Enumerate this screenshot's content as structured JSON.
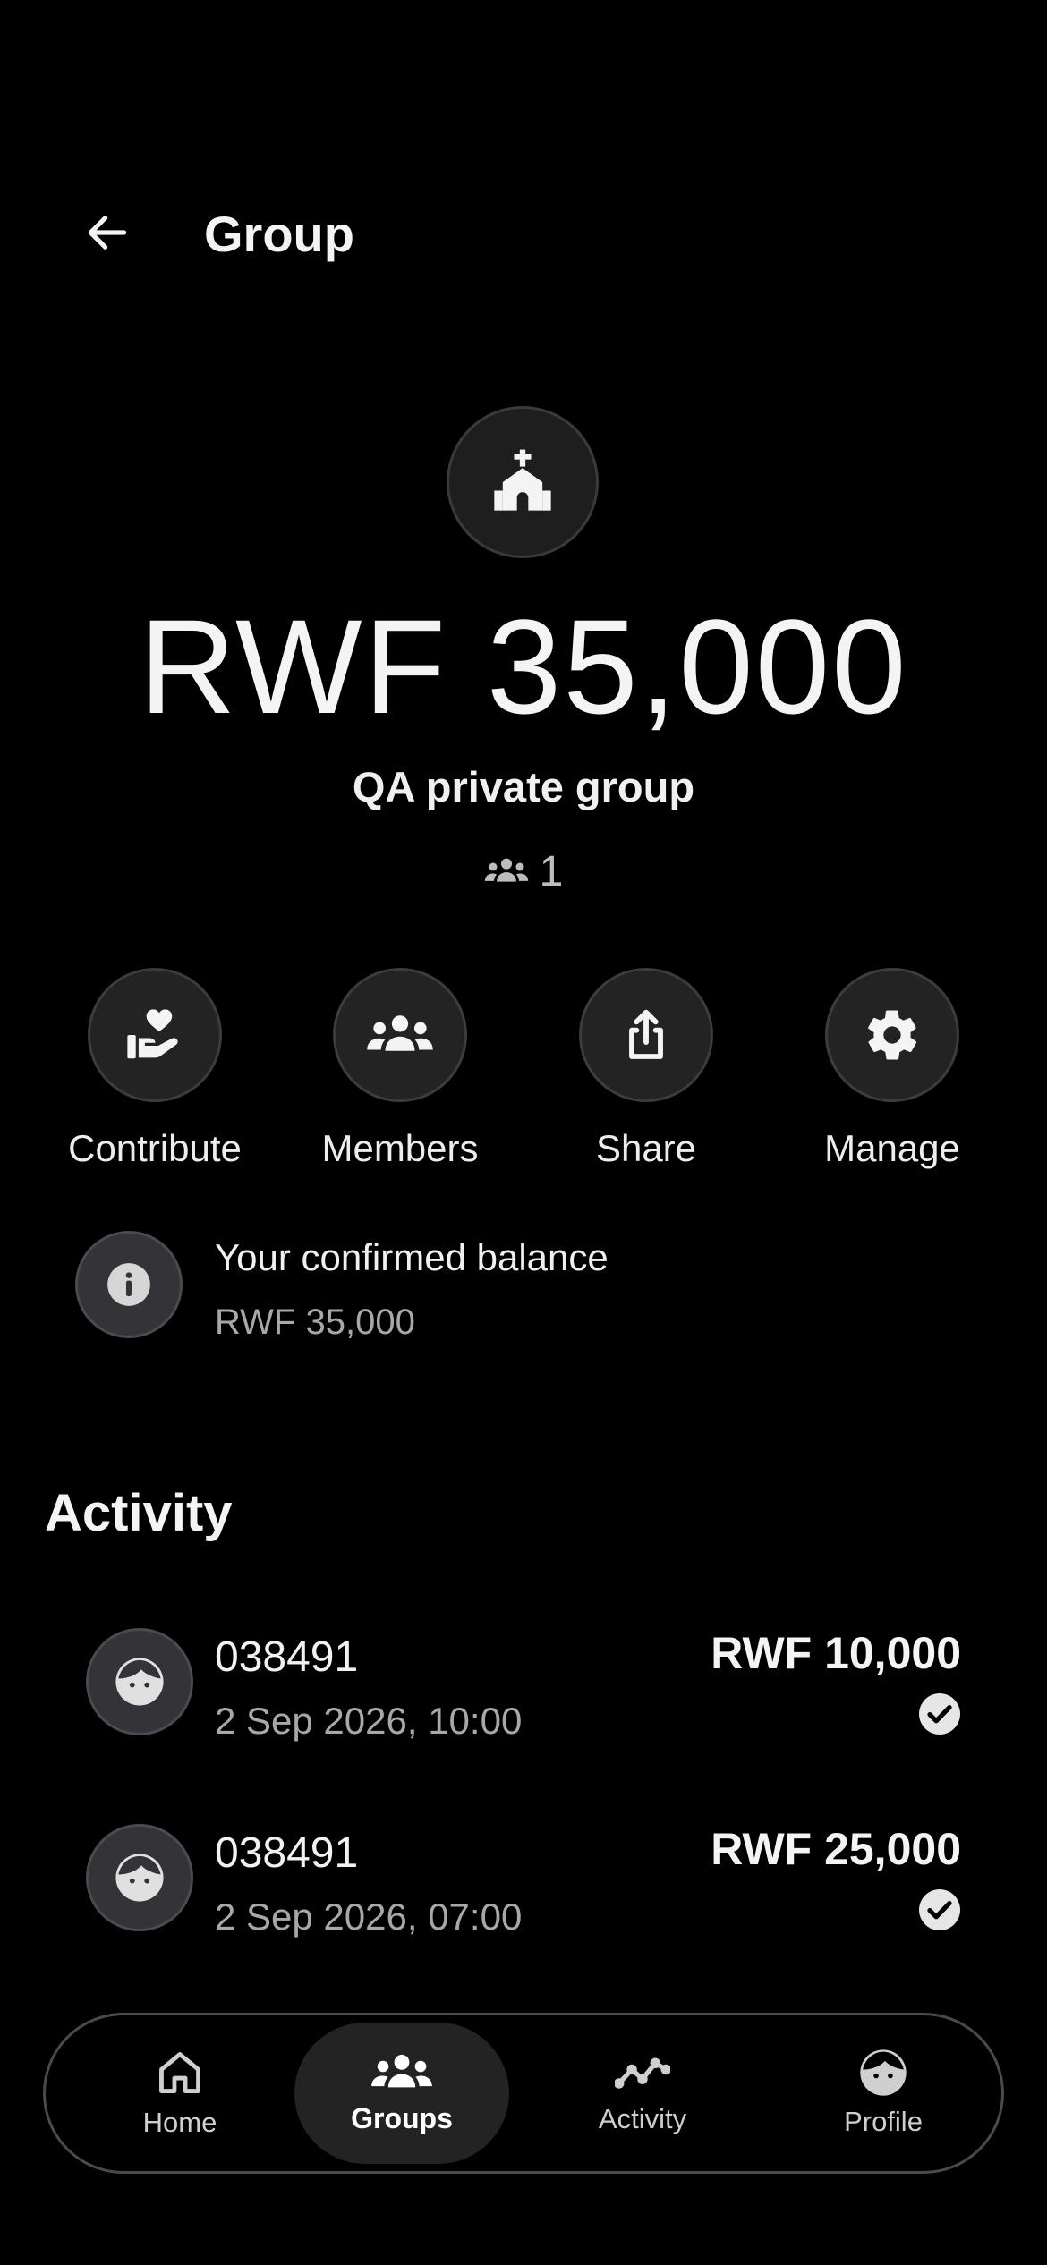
{
  "header": {
    "title": "Group",
    "back_icon": "arrow-left-icon"
  },
  "group": {
    "icon": "church-icon",
    "balance": "RWF 35,000",
    "name": "QA private group",
    "member_count": "1",
    "member_icon": "people-icon"
  },
  "actions": [
    {
      "label": "Contribute",
      "icon": "hand-heart-icon"
    },
    {
      "label": "Members",
      "icon": "people-icon"
    },
    {
      "label": "Share",
      "icon": "share-icon"
    },
    {
      "label": "Manage",
      "icon": "gear-icon"
    }
  ],
  "confirmed": {
    "icon": "info-icon",
    "title": "Your confirmed balance",
    "value": "RWF 35,000"
  },
  "activity": {
    "title": "Activity",
    "items": [
      {
        "name": "038491",
        "date": "2 Sep 2026, 10:00",
        "amount": "RWF 10,000",
        "status_icon": "check-circle-icon"
      },
      {
        "name": "038491",
        "date": "2 Sep 2026, 07:00",
        "amount": "RWF 25,000",
        "status_icon": "check-circle-icon"
      }
    ]
  },
  "nav": {
    "items": [
      {
        "label": "Home",
        "icon": "home-icon"
      },
      {
        "label": "Groups",
        "icon": "people-icon"
      },
      {
        "label": "Activity",
        "icon": "chart-line-icon"
      },
      {
        "label": "Profile",
        "icon": "face-icon"
      }
    ],
    "active": "Groups"
  },
  "colors": {
    "background": "#000000",
    "surface": "#232323",
    "border": "#3c3c3c",
    "text": "#f2f2f2",
    "muted": "#a8a8a8"
  }
}
